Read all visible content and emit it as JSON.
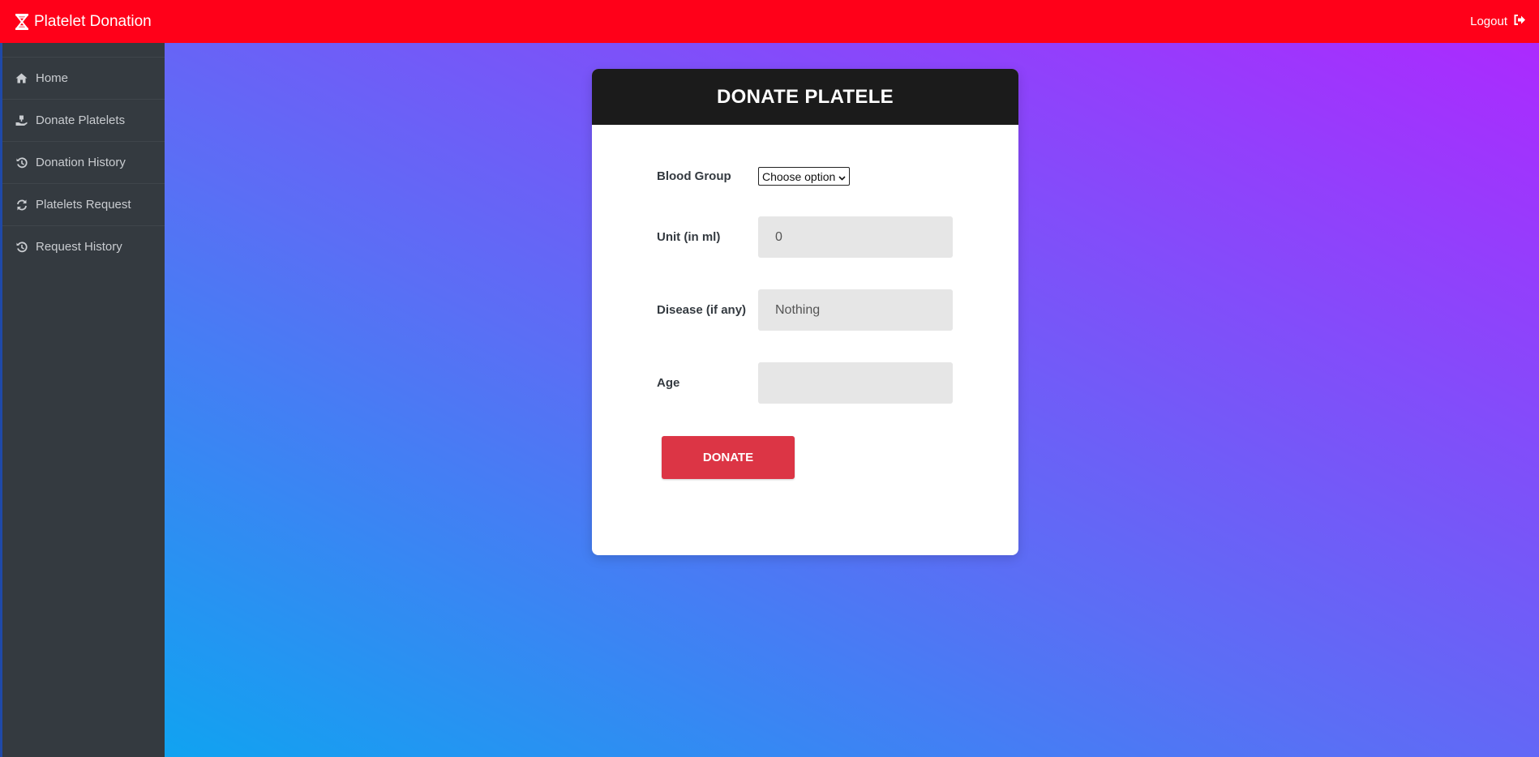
{
  "topbar": {
    "brand": "Platelet Donation",
    "brand_icon": "hourglass-dna-icon",
    "logout_label": "Logout",
    "logout_icon": "sign-out-icon",
    "background": "#ff0019"
  },
  "sidebar": {
    "items": [
      {
        "label": "Home",
        "icon": "home-icon"
      },
      {
        "label": "Donate Platelets",
        "icon": "hand-donate-icon"
      },
      {
        "label": "Donation History",
        "icon": "history-icon"
      },
      {
        "label": "Platelets Request",
        "icon": "refresh-icon"
      },
      {
        "label": "Request History",
        "icon": "history-icon"
      }
    ],
    "background": "#343a40"
  },
  "form": {
    "title": "DONATE PLATELE",
    "blood_group": {
      "label": "Blood Group",
      "selected": "Choose option"
    },
    "unit": {
      "label": "Unit (in ml)",
      "value": "0"
    },
    "disease": {
      "label": "Disease (if any)",
      "value": "Nothing"
    },
    "age": {
      "label": "Age",
      "value": ""
    },
    "submit_label": "DONATE",
    "submit_color": "#dc3545"
  }
}
